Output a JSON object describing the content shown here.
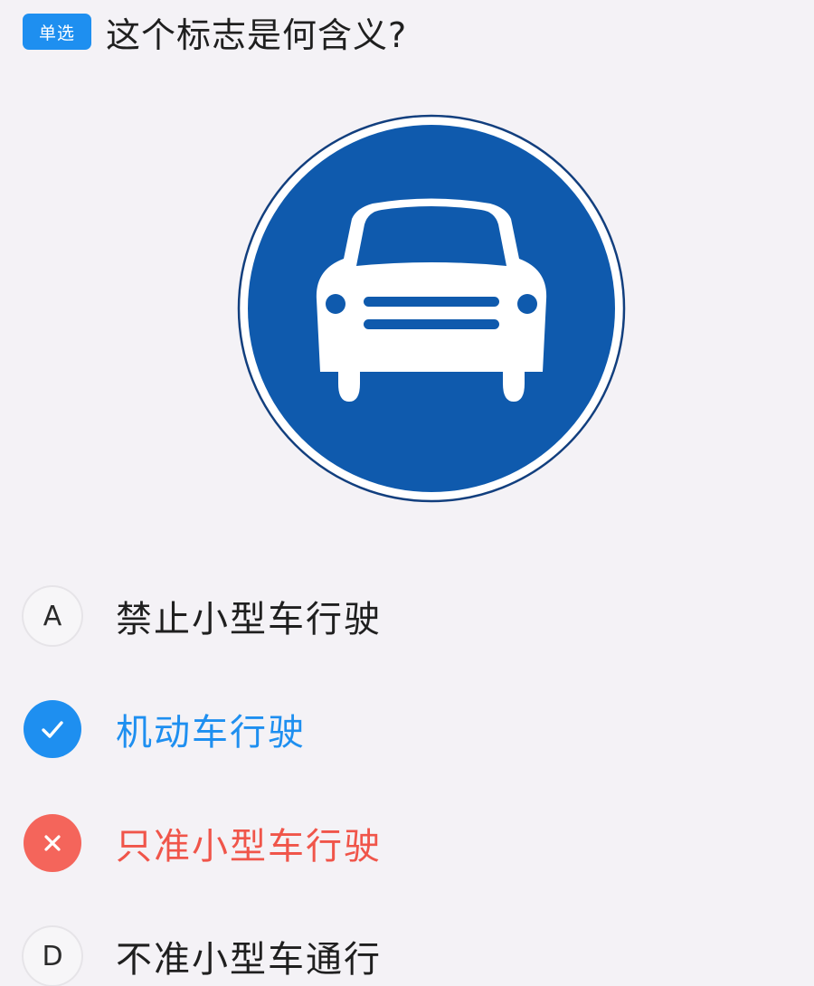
{
  "question": {
    "type_badge": "单选",
    "text": "这个标志是何含义?"
  },
  "sign": {
    "icon": "car-front-icon",
    "colors": {
      "blue": "#0f5aad",
      "white": "#ffffff",
      "outline": "#123f7e"
    }
  },
  "options": [
    {
      "marker": "A",
      "text": "禁止小型车行驶",
      "state": "unselected"
    },
    {
      "marker": "check-icon",
      "text": "机动车行驶",
      "state": "correct"
    },
    {
      "marker": "close-icon",
      "text": "只准小型车行驶",
      "state": "wrong"
    },
    {
      "marker": "D",
      "text": "不准小型车通行",
      "state": "unselected"
    }
  ],
  "colors": {
    "accent_blue": "#1e8ff0",
    "error_red": "#f4655b",
    "background": "#f4f2f6"
  }
}
